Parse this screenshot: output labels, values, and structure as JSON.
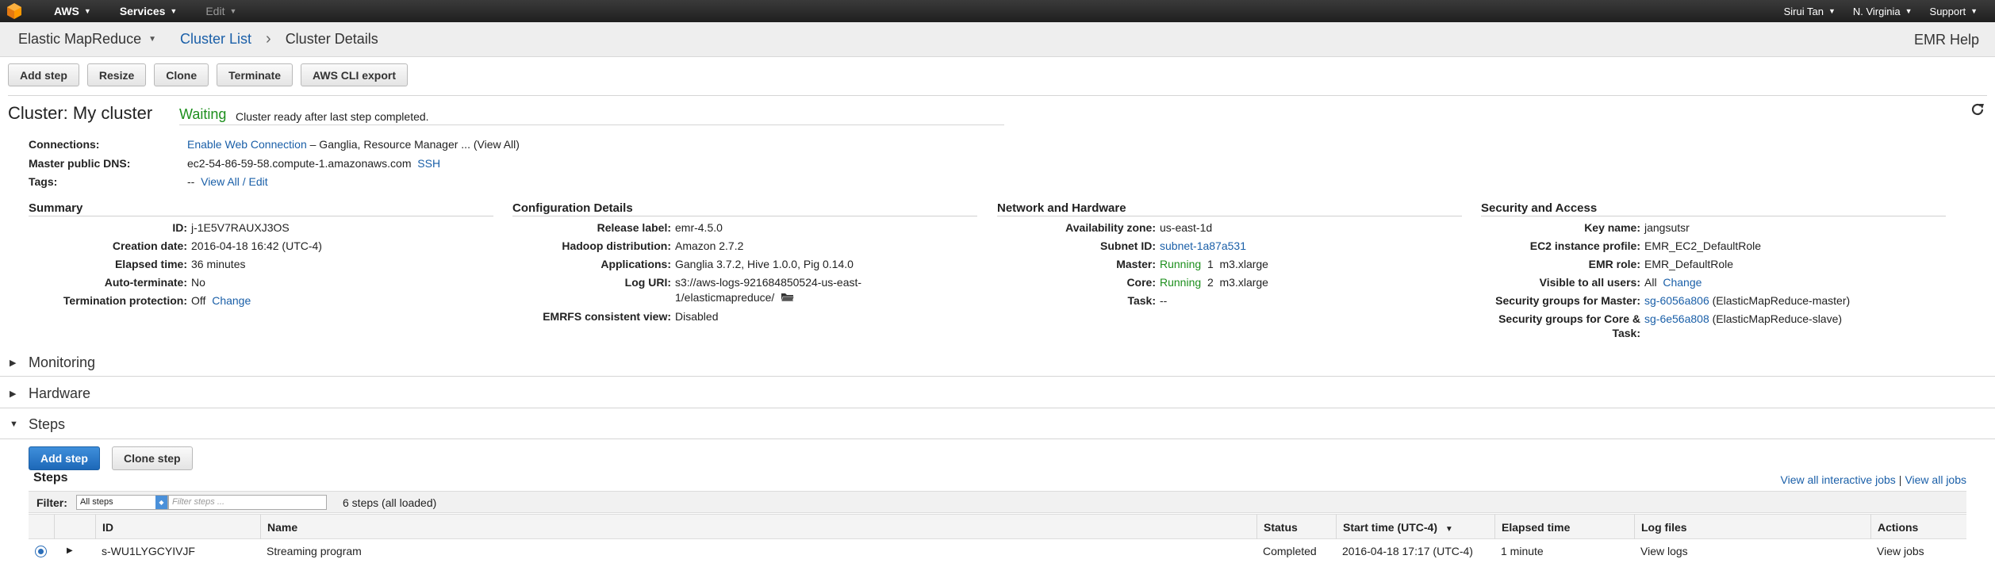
{
  "topnav": {
    "brand": "AWS",
    "services": "Services",
    "edit": "Edit",
    "user": "Sirui Tan",
    "region": "N. Virginia",
    "support": "Support"
  },
  "breadcrumb": {
    "service": "Elastic MapReduce",
    "cluster_list": "Cluster List",
    "current": "Cluster Details",
    "help": "EMR Help"
  },
  "toolbar": {
    "add_step": "Add step",
    "resize": "Resize",
    "clone": "Clone",
    "terminate": "Terminate",
    "cli_export": "AWS CLI export"
  },
  "cluster": {
    "title": "Cluster: My cluster",
    "state": "Waiting",
    "state_message": "Cluster ready after last step completed.",
    "connections_label": "Connections:",
    "connections_link": "Enable Web Connection",
    "connections_rest": "– Ganglia, Resource Manager ... (View All)",
    "dns_label": "Master public DNS:",
    "dns_value": "ec2-54-86-59-58.compute-1.amazonaws.com",
    "dns_ssh": "SSH",
    "tags_label": "Tags:",
    "tags_value": "--",
    "tags_link": "View All / Edit"
  },
  "summary": {
    "heading": "Summary",
    "id_label": "ID:",
    "id_value": "j-1E5V7RAUXJ3OS",
    "creation_label": "Creation date:",
    "creation_value": "2016-04-18 16:42 (UTC-4)",
    "elapsed_label": "Elapsed time:",
    "elapsed_value": "36 minutes",
    "autoterm_label": "Auto-terminate:",
    "autoterm_value": "No",
    "termprot_label": "Termination protection:",
    "termprot_value": "Off",
    "termprot_change": "Change"
  },
  "config": {
    "heading": "Configuration Details",
    "release_label": "Release label:",
    "release_value": "emr-4.5.0",
    "hadoop_label": "Hadoop distribution:",
    "hadoop_value": "Amazon 2.7.2",
    "apps_label": "Applications:",
    "apps_value": "Ganglia 3.7.2, Hive 1.0.0, Pig 0.14.0",
    "log_label": "Log URI:",
    "log_value_line1": "s3://aws-logs-921684850524-us-east-",
    "log_value_line2": "1/elasticmapreduce/",
    "emrfs_label": "EMRFS consistent view:",
    "emrfs_value": "Disabled"
  },
  "network": {
    "heading": "Network and Hardware",
    "az_label": "Availability zone:",
    "az_value": "us-east-1d",
    "subnet_label": "Subnet ID:",
    "subnet_value": "subnet-1a87a531",
    "master_label": "Master:",
    "master_status": "Running",
    "master_value": "1  m3.xlarge",
    "core_label": "Core:",
    "core_status": "Running",
    "core_value": "2  m3.xlarge",
    "task_label": "Task:",
    "task_value": "--"
  },
  "security": {
    "heading": "Security and Access",
    "key_label": "Key name:",
    "key_value": "jangsutsr",
    "profile_label": "EC2 instance profile:",
    "profile_value": "EMR_EC2_DefaultRole",
    "role_label": "EMR role:",
    "role_value": "EMR_DefaultRole",
    "visible_label": "Visible to all users:",
    "visible_value": "All",
    "visible_change": "Change",
    "sg_master_label": "Security groups for Master:",
    "sg_master_link": "sg-6056a806",
    "sg_master_rest": "(ElasticMapReduce-master)",
    "sg_core_label_1": "Security groups for Core &",
    "sg_core_label_2": "Task:",
    "sg_core_link": "sg-6e56a808",
    "sg_core_rest": "(ElasticMapReduce-slave)"
  },
  "sections": {
    "monitoring": "Monitoring",
    "hardware": "Hardware",
    "steps": "Steps"
  },
  "steps": {
    "add_step": "Add step",
    "clone_step": "Clone step",
    "title": "Steps",
    "view_interactive": "View all interactive jobs",
    "view_all": "View all jobs",
    "filter_label": "Filter:",
    "filter_select": "All steps",
    "filter_placeholder": "Filter steps ...",
    "count": "6 steps (all loaded)",
    "columns": {
      "id": "ID",
      "name": "Name",
      "status": "Status",
      "start": "Start time (UTC-4)",
      "elapsed": "Elapsed time",
      "logs": "Log files",
      "actions": "Actions"
    },
    "rows": [
      {
        "id": "s-WU1LYGCYIVJF",
        "name": "Streaming program",
        "status": "Completed",
        "start": "2016-04-18 17:17 (UTC-4)",
        "elapsed": "1 minute",
        "logs": "View logs",
        "actions": "View jobs"
      }
    ]
  },
  "icons": {
    "aws_logo": "aws-cube-logo",
    "refresh": "refresh-icon",
    "folder": "folder-icon",
    "sort": "sort-down-icon"
  },
  "colors": {
    "link": "#1a5fa8",
    "running": "#1d8f1d",
    "primary_button": "#1d68b8",
    "topbar": "#232323"
  }
}
